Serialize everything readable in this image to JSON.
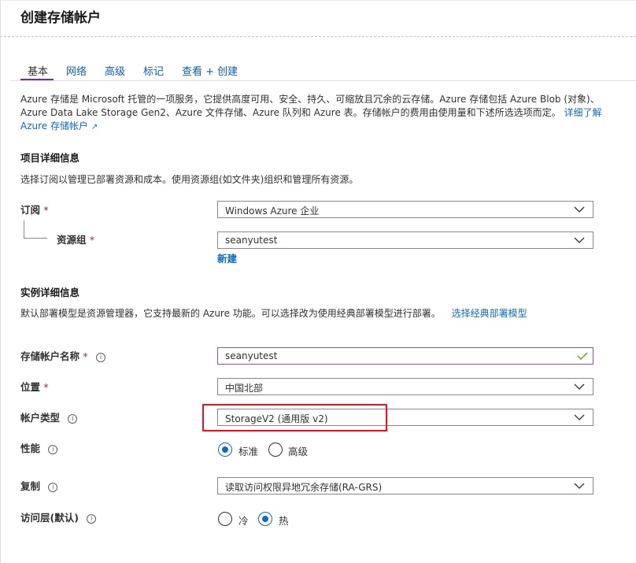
{
  "page": {
    "title": "创建存储帐户"
  },
  "tabs": [
    {
      "label": "基本",
      "active": true
    },
    {
      "label": "网络",
      "active": false
    },
    {
      "label": "高级",
      "active": false
    },
    {
      "label": "标记",
      "active": false
    },
    {
      "label": "查看 + 创建",
      "active": false
    }
  ],
  "intro": {
    "text": "Azure 存储是 Microsoft 托管的一项服务，它提供高度可用、安全、持久、可缩放且冗余的云存储。Azure 存储包括 Azure Blob (对象)、Azure Data Lake Storage Gen2、Azure 文件存储、Azure 队列和 Azure 表。存储帐户的费用由使用量和下述所选选项而定。",
    "link": "详细了解 Azure 存储帐户",
    "link_icon": "external-link-icon"
  },
  "project": {
    "heading": "项目详细信息",
    "desc": "选择订阅以管理已部署资源和成本。使用资源组(如文件夹)组织和管理所有资源。",
    "subscription_label": "订阅",
    "subscription_value": "Windows Azure 企业",
    "resource_group_label": "资源组",
    "resource_group_value": "seanyutest",
    "new_link": "新建"
  },
  "instance": {
    "heading": "实例详细信息",
    "desc": "默认部署模型是资源管理器，它支持最新的 Azure 功能。可以选择改为使用经典部署模型进行部署。",
    "classic_link": "选择经典部署模型",
    "name_label": "存储帐户名称",
    "name_value": "seanyutest",
    "location_label": "位置",
    "location_value": "中国北部",
    "account_type_label": "帐户类型",
    "account_type_value": "StorageV2 (通用版 v2)",
    "performance_label": "性能",
    "performance_options": [
      "标准",
      "高级"
    ],
    "performance_selected": "标准",
    "replication_label": "复制",
    "replication_value": "读取访问权限异地冗余存储(RA-GRS)",
    "access_tier_label": "访问层(默认)",
    "access_tier_options": [
      "冷",
      "热"
    ],
    "access_tier_selected": "热"
  },
  "symbols": {
    "required": "*",
    "info": "i"
  },
  "colors": {
    "accent": "#0f6cbd",
    "tab_underline": "#6b2fa6",
    "required": "#a4262c",
    "highlight": "#e81123",
    "valid": "#57a300"
  }
}
